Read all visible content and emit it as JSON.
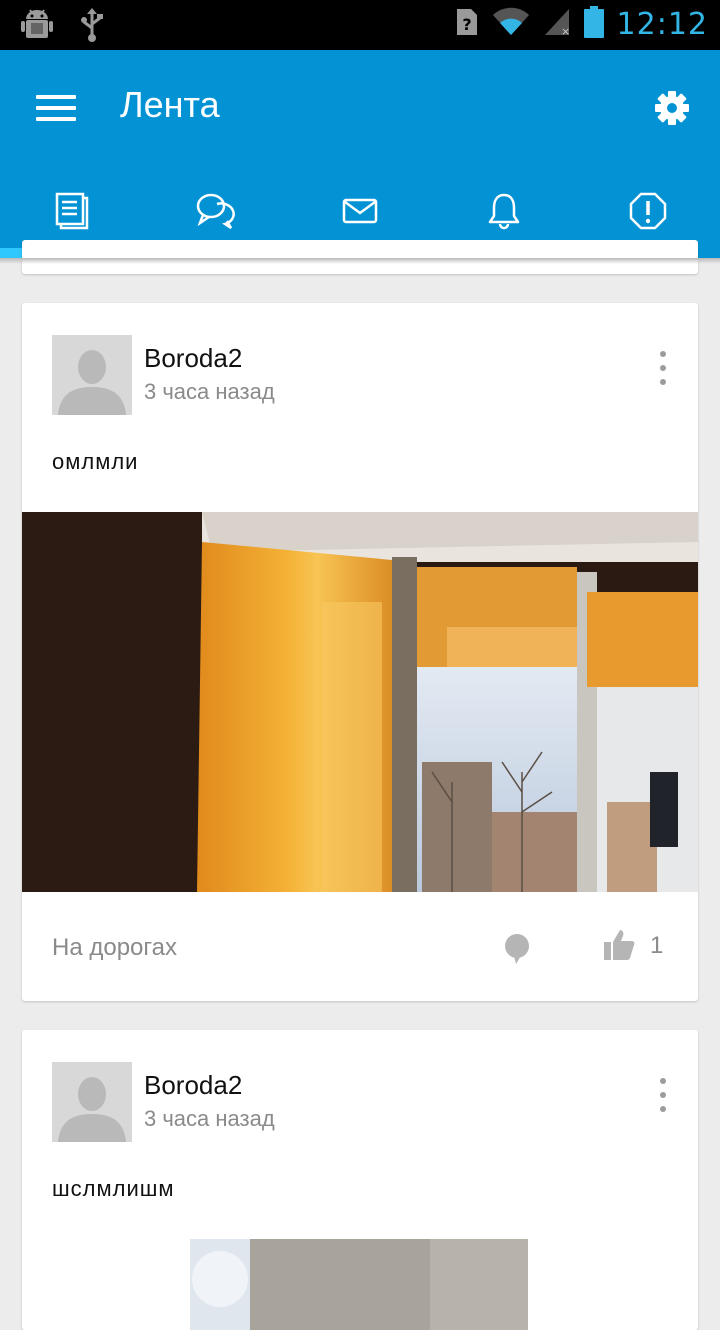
{
  "status_bar": {
    "time": "12:12",
    "icons": [
      "android-debug-icon",
      "usb-icon",
      "sim-unknown-icon",
      "wifi-icon",
      "signal-icon",
      "battery-icon"
    ],
    "accent": "#33b5e5"
  },
  "app_bar": {
    "title": "Лента",
    "color": "#0392d3",
    "menu_icon": "hamburger-icon",
    "settings_icon": "gear-icon"
  },
  "tabs": [
    {
      "name": "feed",
      "icon": "newspaper-icon",
      "selected": true
    },
    {
      "name": "chats",
      "icon": "chat-bubbles-icon",
      "selected": false
    },
    {
      "name": "messages",
      "icon": "envelope-icon",
      "selected": false
    },
    {
      "name": "notifications",
      "icon": "bell-icon",
      "selected": false
    },
    {
      "name": "alerts",
      "icon": "exclamation-icon",
      "selected": false
    }
  ],
  "posts": [
    {
      "author": "Boroda2",
      "time": "3 часа назад",
      "text": "омлмли",
      "photo": "window-with-orange-blinds",
      "category": "На дорогах",
      "likes": "1"
    },
    {
      "author": "Boroda2",
      "time": "3 часа назад",
      "text": "шслмлишм",
      "photo": "window-photo"
    }
  ]
}
